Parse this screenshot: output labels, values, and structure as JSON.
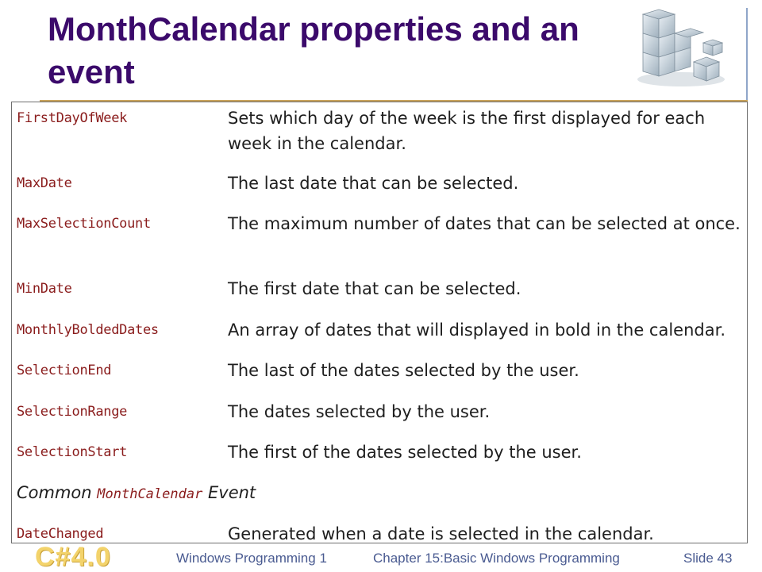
{
  "slide": {
    "title": "MonthCalendar properties and an event"
  },
  "table": {
    "rows": [
      {
        "property": "FirstDayOfWeek",
        "description": "Sets which day of the week is the first displayed for each week in the calendar."
      },
      {
        "property": "MaxDate",
        "description": "The last date that can be selected."
      },
      {
        "property": "MaxSelectionCount",
        "description": "The maximum number of dates that can be selected at once."
      },
      {
        "property": "MinDate",
        "description": "The first date that can be selected."
      },
      {
        "property": "MonthlyBoldedDates",
        "description": "An array of dates that will displayed in bold in the calendar."
      },
      {
        "property": "SelectionEnd",
        "description": "The last of the dates selected by the user."
      },
      {
        "property": "SelectionRange",
        "description": "The dates selected by the user."
      },
      {
        "property": "SelectionStart",
        "description": "The first of the dates selected by the user."
      }
    ],
    "section": {
      "prefix": "Common ",
      "code": "MonthCalendar",
      "suffix": " Event"
    },
    "event_rows": [
      {
        "property": "DateChanged",
        "description": "Generated when a date is selected in the calendar."
      }
    ]
  },
  "footer": {
    "left": "Windows Programming 1",
    "center": "Chapter 15:Basic Windows Programming",
    "right": "Slide 43"
  },
  "logo": {
    "text": "C#4.0"
  },
  "colors": {
    "title": "#3b0a6b",
    "property_name": "#8a1c1c",
    "footer_text": "#4a5b91"
  },
  "icons": {
    "decoration": "cubes-icon"
  }
}
